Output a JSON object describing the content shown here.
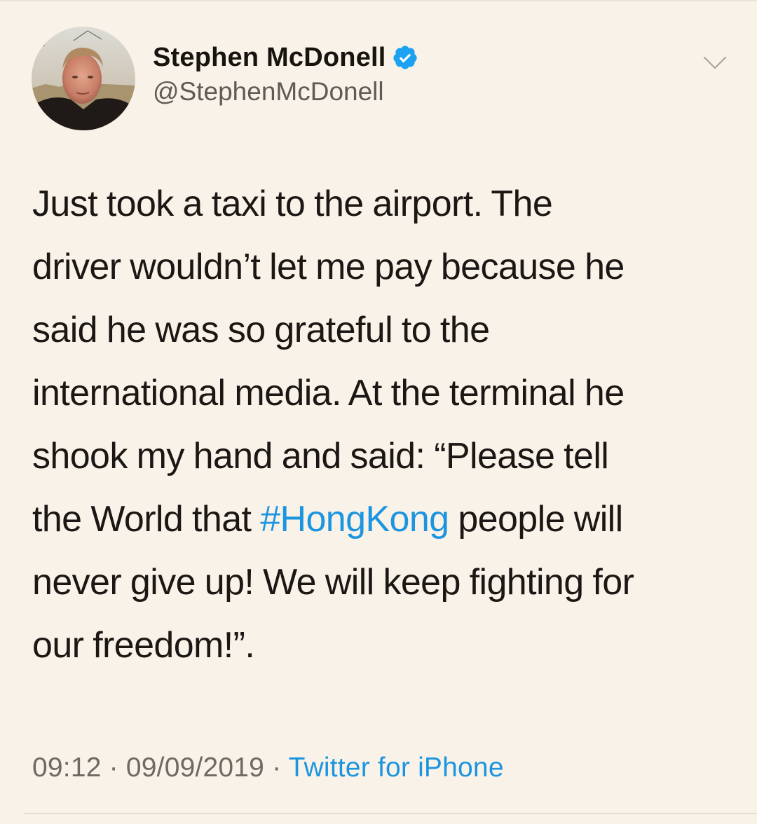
{
  "author": {
    "display_name": "Stephen McDonell",
    "handle": "@StephenMcDonell",
    "verified": true,
    "avatar": "profile-photo"
  },
  "tweet": {
    "lines": [
      "Just took a taxi to the airport. The",
      "driver wouldn’t let me pay because he",
      "said he was so grateful to the",
      "international media. At the terminal he",
      "shook my hand and said: “Please tell"
    ],
    "line6_before": "the World that ",
    "hashtag": "#HongKong",
    "line6_after": " people will",
    "line7": "never give up! We will keep fighting for",
    "line8": "our freedom!”."
  },
  "meta": {
    "time": "09:12",
    "separator": " · ",
    "date": "09/09/2019",
    "separator2": " · ",
    "source": "Twitter for iPhone"
  },
  "icons": {
    "verified": "verified-badge-icon",
    "menu": "chevron-down-icon"
  },
  "colors": {
    "background": "#f9f2e8",
    "link": "#1b95e0",
    "verified": "#1da1f2",
    "secondary_text": "#6d6963"
  }
}
